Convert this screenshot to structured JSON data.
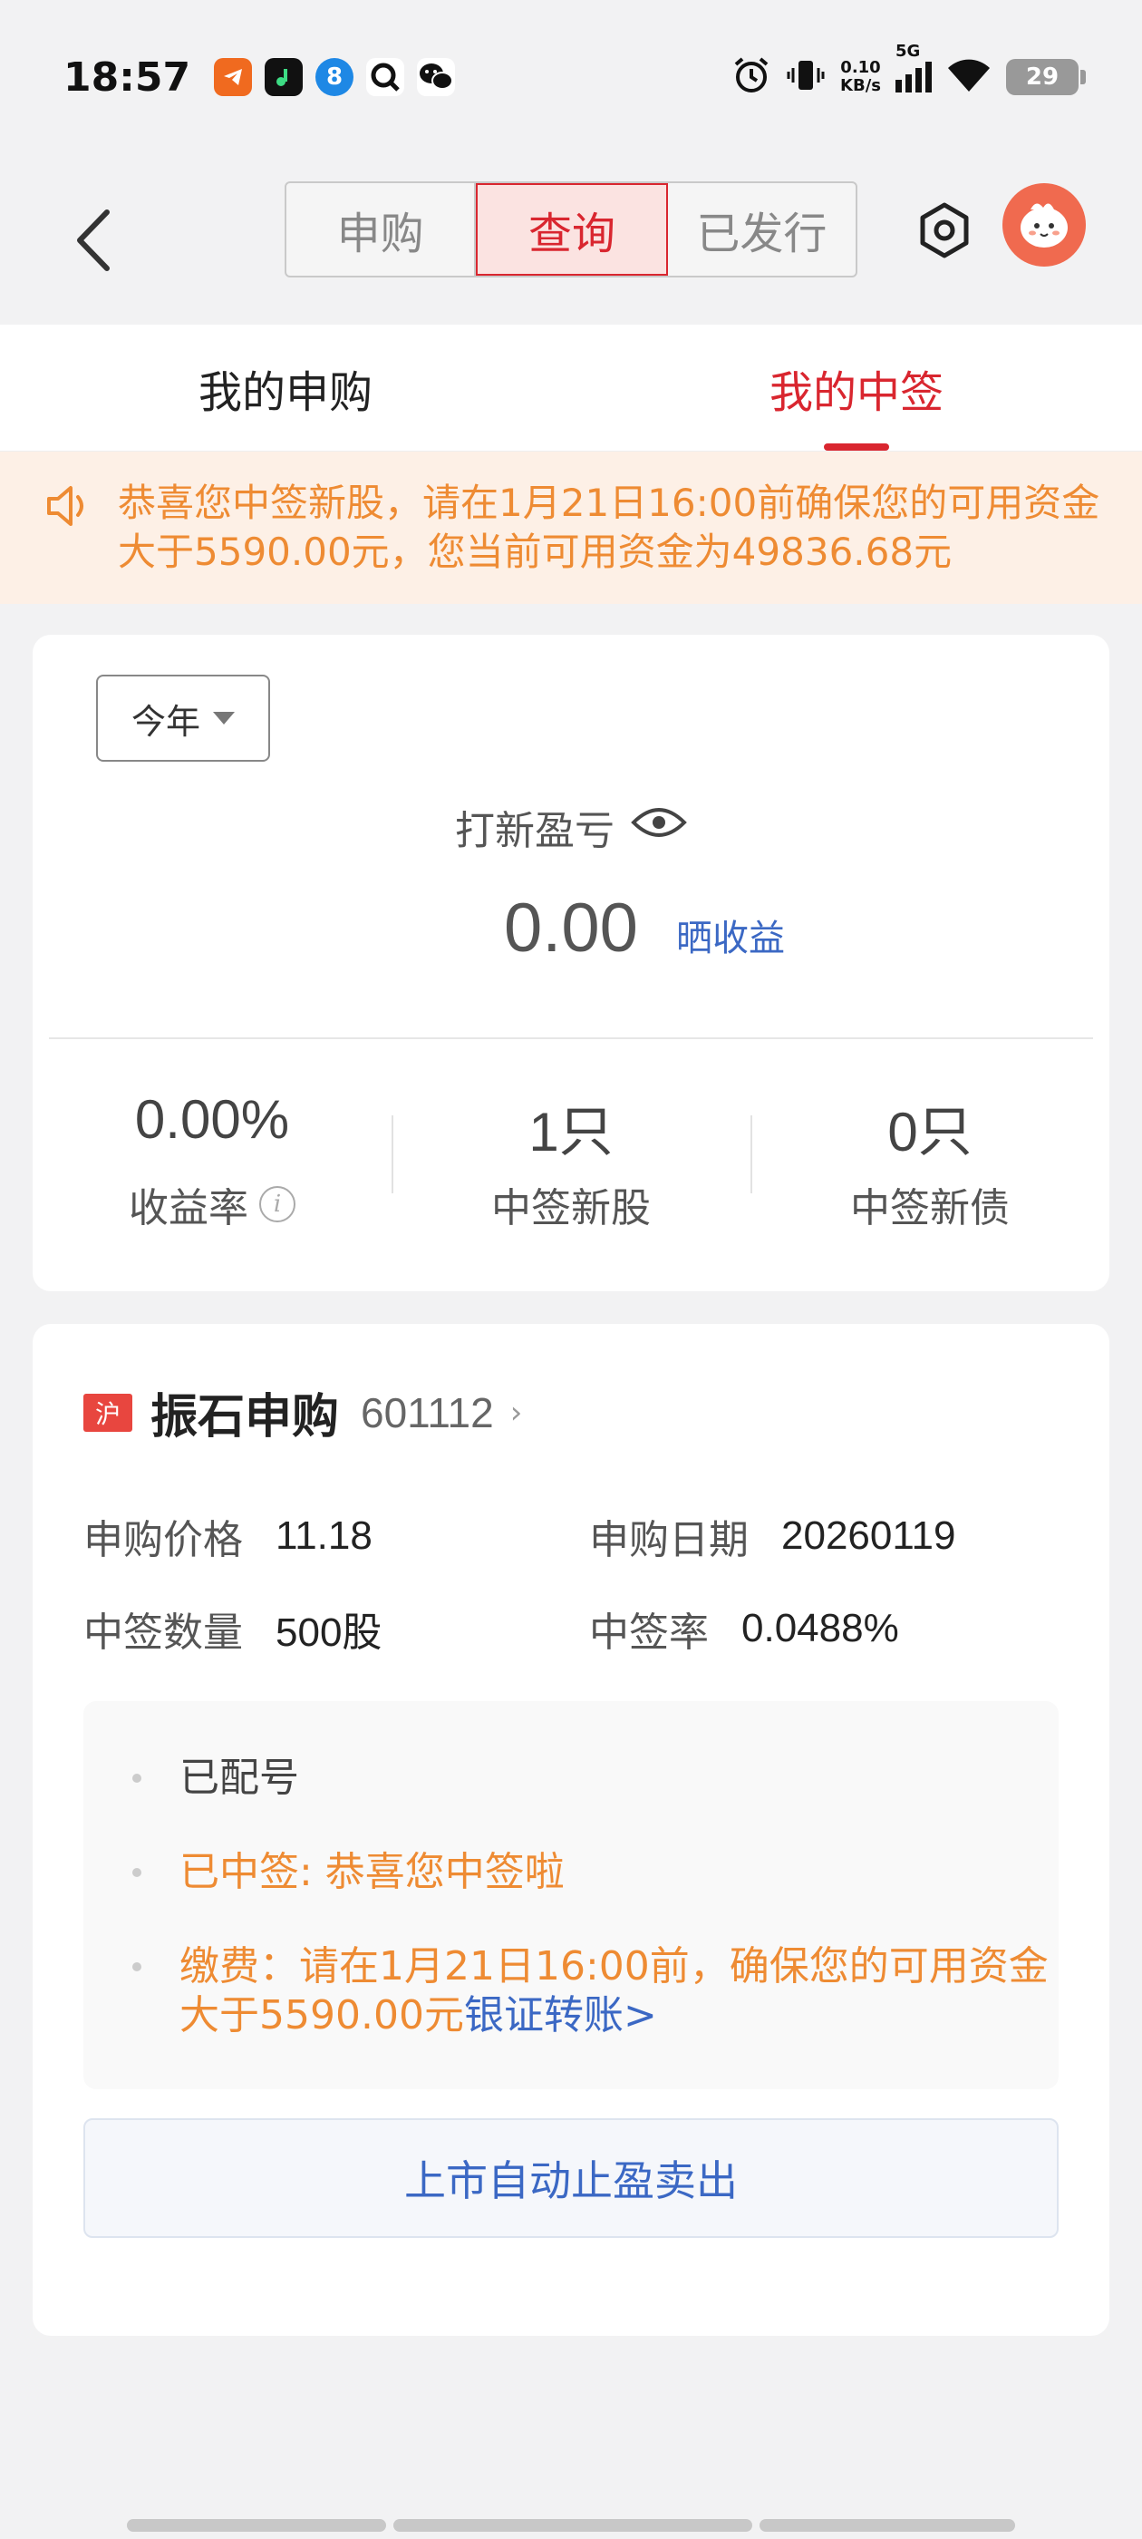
{
  "status_bar": {
    "time": "18:57",
    "net_speed_value": "0.10",
    "net_speed_unit": "KB/s",
    "signal_label": "5G",
    "battery": "29",
    "icons": [
      "telegram-app-icon",
      "music-app-icon",
      "blue-app-icon",
      "search-app-icon",
      "wechat-app-icon",
      "alarm-icon",
      "vibrate-icon",
      "signal-icon",
      "wifi-icon",
      "battery-icon"
    ]
  },
  "header": {
    "segments": [
      {
        "label": "申购",
        "active": false
      },
      {
        "label": "查询",
        "active": true
      },
      {
        "label": "已发行",
        "active": false
      }
    ]
  },
  "tabs": [
    {
      "label": "我的申购",
      "active": false
    },
    {
      "label": "我的中签",
      "active": true
    }
  ],
  "notice": {
    "text": "恭喜您中签新股，请在1月21日16:00前确保您的可用资金大于5590.00元，您当前可用资金为49836.68元"
  },
  "summary": {
    "period": "今年",
    "pl_label": "打新盈亏",
    "pl_value": "0.00",
    "share_label": "晒收益",
    "stats": [
      {
        "value": "0.00%",
        "label": "收益率"
      },
      {
        "value": "1只",
        "label": "中签新股"
      },
      {
        "value": "0只",
        "label": "中签新债"
      }
    ]
  },
  "stock": {
    "market": "沪",
    "name": "振石申购",
    "code": "601112",
    "chevron": "›",
    "price_label": "申购价格",
    "price": "11.18",
    "date_label": "申购日期",
    "date": "20260119",
    "qty_label": "中签数量",
    "qty": "500股",
    "rate_label": "中签率",
    "rate": "0.0488%",
    "statuses": {
      "assigned": "已配号",
      "won": "已中签: 恭喜您中签啦",
      "pay_line1": "缴费：请在1月21日16:00前，确保您的可用资金",
      "pay_line2": "大于5590.00元",
      "pay_link": "银证转账>"
    },
    "action_label": "上市自动止盈卖出"
  },
  "colors": {
    "accent_red": "#d9262f",
    "notice_orange": "#ee8b33",
    "link_blue": "#3b68c4"
  }
}
